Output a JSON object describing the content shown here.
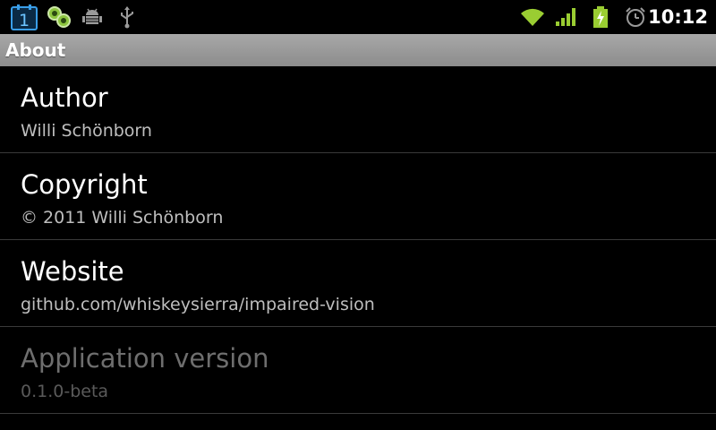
{
  "status_bar": {
    "notification_count": "1",
    "time": "10:12",
    "icons": [
      "calendar-notification-icon",
      "chat-icon",
      "android-debug-icon",
      "usb-icon",
      "wifi-icon",
      "signal-icon",
      "battery-charging-icon",
      "alarm-icon"
    ],
    "accent_color": "#9acd32"
  },
  "title_bar": {
    "title": "About"
  },
  "preferences": [
    {
      "title": "Author",
      "summary": "Willi Schönborn",
      "enabled": true
    },
    {
      "title": "Copyright",
      "summary": "© 2011 Willi Schönborn",
      "enabled": true
    },
    {
      "title": "Website",
      "summary": "github.com/whiskeysierra/impaired-vision",
      "enabled": true
    },
    {
      "title": "Application version",
      "summary": "0.1.0-beta",
      "enabled": false
    }
  ]
}
